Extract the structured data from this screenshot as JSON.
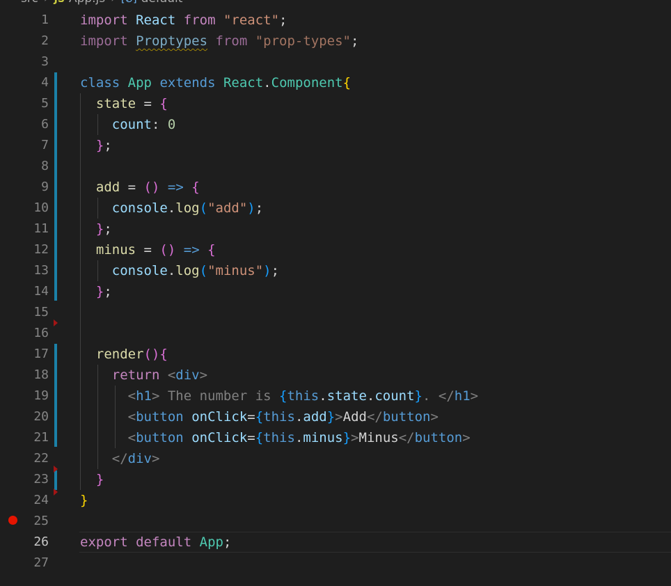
{
  "breadcrumb": {
    "folder": "src",
    "file": "App.js",
    "file_badge": "JS",
    "symbol_badge": "[⊘]",
    "symbol": "default"
  },
  "editor": {
    "current_line": 26,
    "breakpoint_line": 25,
    "lines": [
      {
        "n": "1"
      },
      {
        "n": "2"
      },
      {
        "n": "3"
      },
      {
        "n": "4"
      },
      {
        "n": "5"
      },
      {
        "n": "6"
      },
      {
        "n": "7"
      },
      {
        "n": "8"
      },
      {
        "n": "9"
      },
      {
        "n": "10"
      },
      {
        "n": "11"
      },
      {
        "n": "12"
      },
      {
        "n": "13"
      },
      {
        "n": "14"
      },
      {
        "n": "15"
      },
      {
        "n": "16"
      },
      {
        "n": "17"
      },
      {
        "n": "18"
      },
      {
        "n": "19"
      },
      {
        "n": "20"
      },
      {
        "n": "21"
      },
      {
        "n": "22"
      },
      {
        "n": "23"
      },
      {
        "n": "24"
      },
      {
        "n": "25"
      },
      {
        "n": "26"
      },
      {
        "n": "27"
      }
    ]
  },
  "code": {
    "l1": [
      "import",
      "React",
      "from",
      "\"react\"",
      ";"
    ],
    "l2": [
      "import",
      "Proptypes",
      "from",
      "\"prop-types\"",
      ";"
    ],
    "l4": [
      "class",
      "App",
      "extends",
      "React",
      ".",
      "Component",
      "{"
    ],
    "l5": [
      "state",
      " = ",
      "{"
    ],
    "l6": [
      "count",
      ": ",
      "0"
    ],
    "l7": [
      "}",
      ";"
    ],
    "l9": [
      "add",
      " = ",
      "()",
      " => ",
      "{"
    ],
    "l10": [
      "console",
      ".",
      "log",
      "(",
      "\"add\"",
      ")",
      ";"
    ],
    "l11": [
      "}",
      ";"
    ],
    "l12": [
      "minus",
      " = ",
      "()",
      " => ",
      "{"
    ],
    "l13": [
      "console",
      ".",
      "log",
      "(",
      "\"minus\"",
      ")",
      ";"
    ],
    "l14": [
      "}",
      ";"
    ],
    "l17": [
      "render",
      "()",
      "{"
    ],
    "l18": [
      "return",
      " <",
      "div",
      ">"
    ],
    "l19": [
      "<",
      "h1",
      "> The number is ",
      "{",
      "this",
      ".",
      "state",
      ".",
      "count",
      "}",
      ". </",
      "h1",
      ">"
    ],
    "l20": [
      "<",
      "button",
      " ",
      "onClick",
      "=",
      "{",
      "this",
      ".",
      "add",
      "}",
      ">",
      "Add",
      "</",
      "button",
      ">"
    ],
    "l21": [
      "<",
      "button",
      " ",
      "onClick",
      "=",
      "{",
      "this",
      ".",
      "minus",
      "}",
      ">",
      "Minus",
      "</",
      "button",
      ">"
    ],
    "l22": [
      "</",
      "div",
      ">"
    ],
    "l23": [
      "}"
    ],
    "l24": [
      "}"
    ],
    "l26": [
      "export",
      "default",
      "App",
      ";"
    ]
  },
  "colors": {
    "background": "#1e1e1e",
    "breakpoint": "#e51400",
    "gutter_modified": "#1b81a8",
    "keyword": "#c586c0",
    "storage": "#569cd6",
    "type": "#4ec9b0",
    "string": "#ce9178"
  }
}
